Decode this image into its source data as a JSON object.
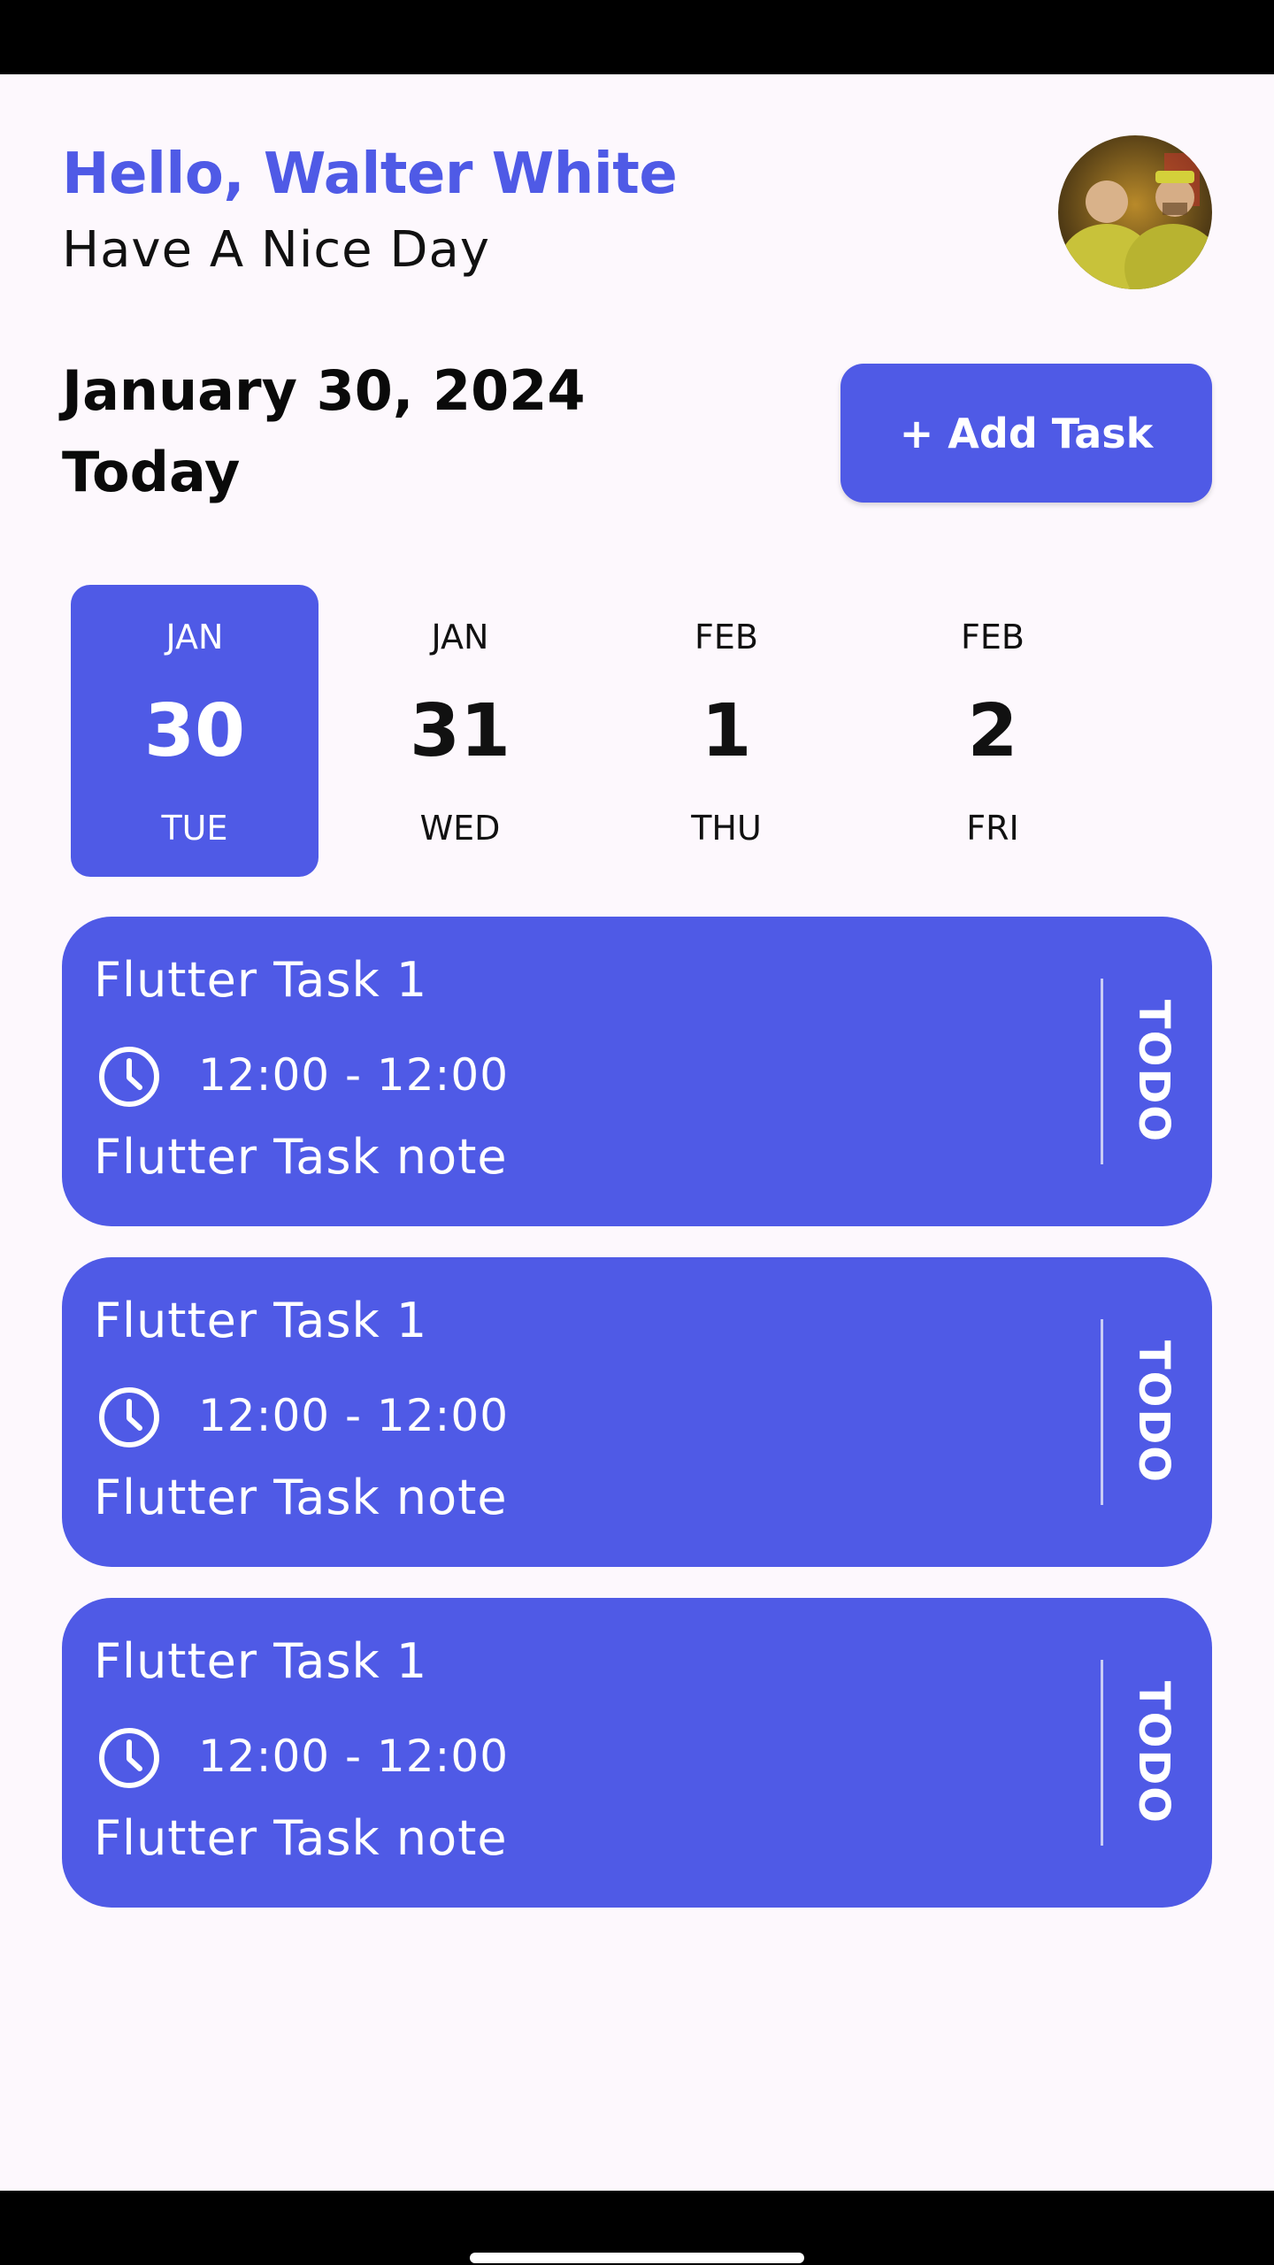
{
  "header": {
    "greeting": "Hello, Walter White",
    "subgreeting": "Have A Nice Day",
    "avatar_icon": "user-avatar"
  },
  "summary": {
    "date": "January 30, 2024",
    "today_label": "Today",
    "add_task_label": "+ Add Task"
  },
  "date_strip": [
    {
      "month": "JAN",
      "day": "30",
      "weekday": "TUE",
      "selected": true
    },
    {
      "month": "JAN",
      "day": "31",
      "weekday": "WED",
      "selected": false
    },
    {
      "month": "FEB",
      "day": "1",
      "weekday": "THU",
      "selected": false
    },
    {
      "month": "FEB",
      "day": "2",
      "weekday": "FRI",
      "selected": false
    }
  ],
  "tasks": [
    {
      "title": "Flutter Task 1",
      "time": "12:00 - 12:00",
      "note": "Flutter Task note",
      "status": "TODO",
      "icon": "clock-icon"
    },
    {
      "title": "Flutter Task 1",
      "time": "12:00 - 12:00",
      "note": "Flutter Task note",
      "status": "TODO",
      "icon": "clock-icon"
    },
    {
      "title": "Flutter Task 1",
      "time": "12:00 - 12:00",
      "note": "Flutter Task note",
      "status": "TODO",
      "icon": "clock-icon"
    }
  ],
  "colors": {
    "accent": "#4f5ae6",
    "background": "#fdf8fd",
    "text": "#111111"
  }
}
